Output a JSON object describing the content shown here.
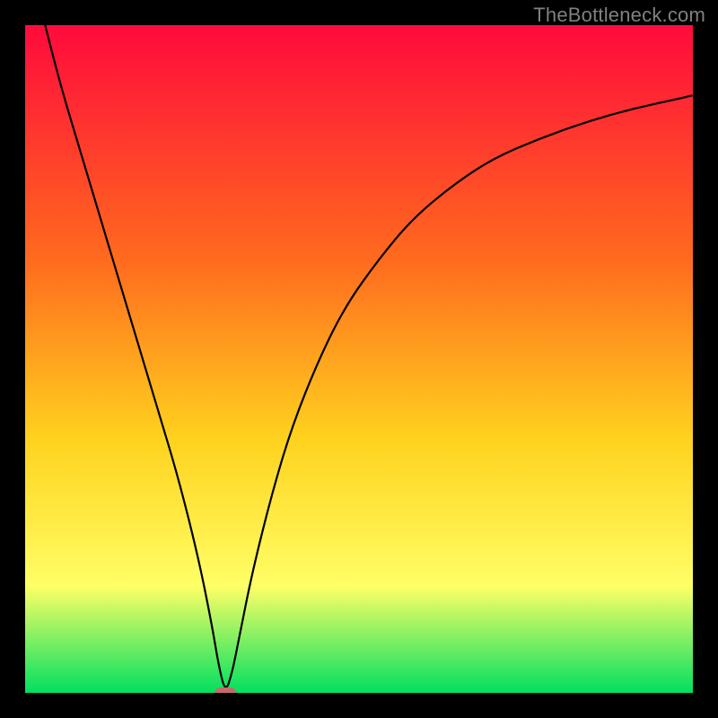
{
  "watermark": "TheBottleneck.com",
  "chart_data": {
    "type": "line",
    "title": "",
    "xlabel": "",
    "ylabel": "",
    "xlim": [
      0,
      100
    ],
    "ylim": [
      0,
      100
    ],
    "grid": false,
    "legend": false,
    "background_gradient": {
      "top": "#ff0a3c",
      "mid_upper": "#ff6a1e",
      "mid": "#ffd21e",
      "mid_lower": "#ffff66",
      "bottom": "#00e060"
    },
    "series": [
      {
        "name": "bottleneck-curve",
        "color": "#000000",
        "x": [
          3,
          5,
          8,
          11,
          14,
          17,
          20,
          23,
          26,
          28,
          29,
          30,
          31,
          32,
          34,
          37,
          40,
          44,
          48,
          53,
          58,
          64,
          70,
          77,
          84,
          91,
          98,
          100
        ],
        "y": [
          100,
          92,
          82,
          72,
          62,
          52,
          42,
          32,
          20,
          10,
          4,
          0,
          3,
          8,
          18,
          30,
          40,
          50,
          58,
          65,
          71,
          76,
          80,
          83,
          85.5,
          87.5,
          89,
          89.5
        ]
      }
    ],
    "marker": {
      "shape": "rounded-rect",
      "color": "#c46a6a",
      "x": 30,
      "y": 0,
      "width_pct": 3.2,
      "height_pct": 1.6
    }
  }
}
